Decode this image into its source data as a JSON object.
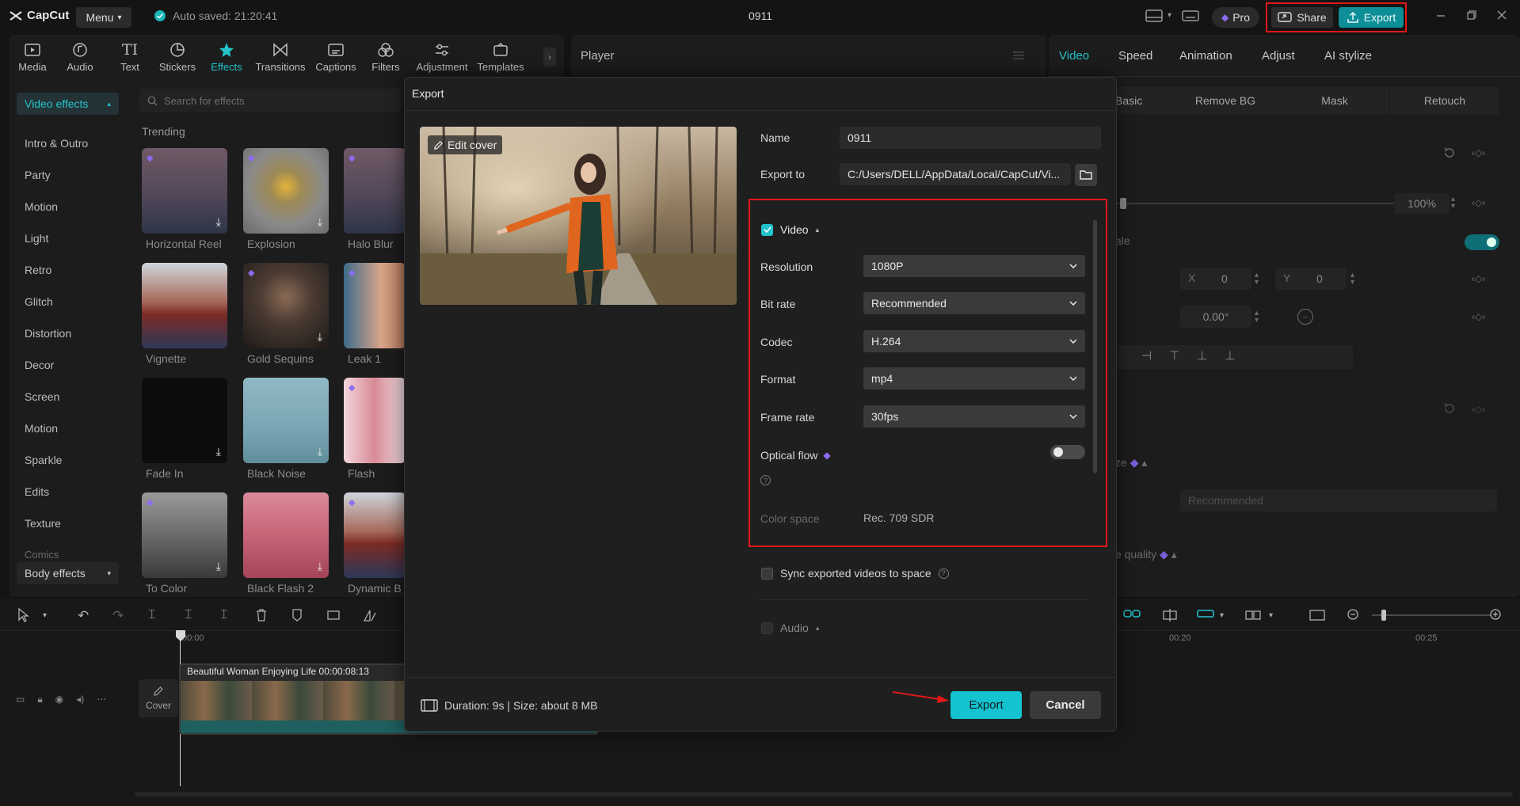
{
  "app": {
    "name": "CapCut",
    "menu_label": "Menu",
    "autosave": "Auto saved: 21:20:41",
    "project_title": "0911",
    "pro_label": "Pro",
    "share_label": "Share",
    "export_label": "Export"
  },
  "toolbar": [
    {
      "label": "Media",
      "icon": "media-icon"
    },
    {
      "label": "Audio",
      "icon": "audio-icon"
    },
    {
      "label": "Text",
      "icon": "text-icon"
    },
    {
      "label": "Stickers",
      "icon": "stickers-icon"
    },
    {
      "label": "Effects",
      "icon": "effects-icon",
      "active": true
    },
    {
      "label": "Transitions",
      "icon": "transitions-icon"
    },
    {
      "label": "Captions",
      "icon": "captions-icon"
    },
    {
      "label": "Filters",
      "icon": "filters-icon"
    },
    {
      "label": "Adjustment",
      "icon": "adjustment-icon"
    },
    {
      "label": "Templates",
      "icon": "templates-icon"
    }
  ],
  "sidebar": {
    "header": "Video effects",
    "items": [
      "Intro & Outro",
      "Party",
      "Motion",
      "Light",
      "Retro",
      "Glitch",
      "Distortion",
      "Decor",
      "Screen",
      "Motion",
      "Sparkle",
      "Edits",
      "Texture",
      "Comics"
    ],
    "footer": "Body effects"
  },
  "effects": {
    "search_placeholder": "Search for effects",
    "section": "Trending",
    "items": [
      "Horizontal Reel",
      "Explosion",
      "Halo Blur",
      "Vignette",
      "Gold Sequins",
      "Leak 1",
      "Fade In",
      "Black Noise",
      "Flash",
      "To Color",
      "Black Flash 2",
      "Dynamic B"
    ]
  },
  "player": {
    "title": "Player"
  },
  "right_panel": {
    "tabs": [
      "Video",
      "Speed",
      "Animation",
      "Adjust",
      "AI stylize"
    ],
    "subtabs": [
      "Basic",
      "Remove BG",
      "Mask",
      "Retouch"
    ],
    "scale_value": "100%",
    "x_label": "X",
    "x_value": "0",
    "y_label": "Y",
    "y_value": "0",
    "rotation": "0.00°",
    "scale_label": "ale",
    "enhance_label": "ze",
    "enhance_value": "Recommended",
    "quality_label": "e quality"
  },
  "timeline": {
    "clip_label": "Beautiful Woman Enjoying Life   00:00:08:13",
    "cover_label": "Cover",
    "ruler": [
      "00:00",
      "00:20",
      "00:25"
    ]
  },
  "export_dialog": {
    "title": "Export",
    "edit_cover": "Edit cover",
    "name_label": "Name",
    "name_value": "0911",
    "export_to_label": "Export to",
    "export_to_value": "C:/Users/DELL/AppData/Local/CapCut/Vi...",
    "video_section": "Video",
    "resolution_label": "Resolution",
    "resolution_value": "1080P",
    "bitrate_label": "Bit rate",
    "bitrate_value": "Recommended",
    "codec_label": "Codec",
    "codec_value": "H.264",
    "format_label": "Format",
    "format_value": "mp4",
    "framerate_label": "Frame rate",
    "framerate_value": "30fps",
    "optical_flow_label": "Optical flow",
    "color_space_label": "Color space",
    "color_space_value": "Rec. 709 SDR",
    "sync_label": "Sync exported videos to space",
    "audio_section": "Audio",
    "duration_text": "Duration: 9s | Size: about 8 MB",
    "export_button": "Export",
    "cancel_button": "Cancel"
  },
  "colors": {
    "accent": "#13c3d0",
    "highlight": "#e01818",
    "background": "#141414",
    "panel": "#1c1c1c"
  }
}
